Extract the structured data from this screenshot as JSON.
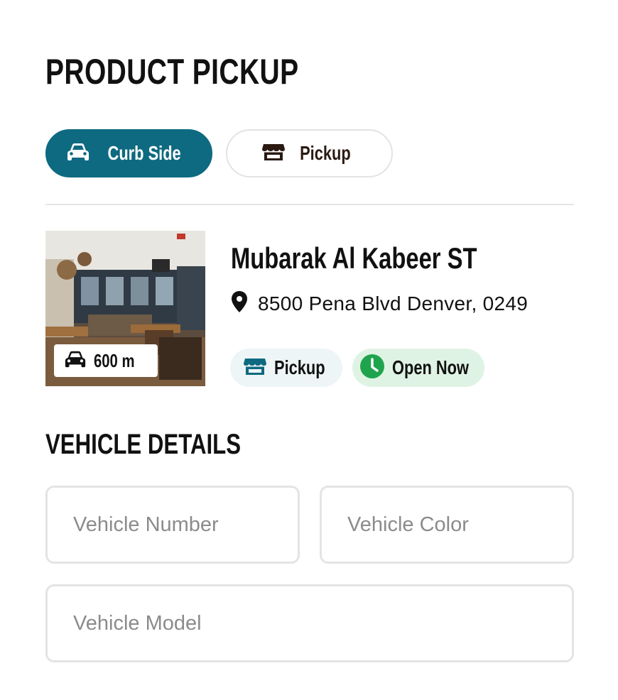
{
  "page": {
    "title": "PRODUCT PICKUP"
  },
  "mode_toggle": {
    "options": [
      {
        "label": "Curb Side",
        "icon": "car-icon",
        "active": true
      },
      {
        "label": "Pickup",
        "icon": "store-icon",
        "active": false
      }
    ]
  },
  "store": {
    "name": "Mubarak Al Kabeer ST",
    "address": "8500 Pena Blvd Denver, 0249",
    "distance": "600 m",
    "chips": {
      "pickup": "Pickup",
      "status": "Open Now"
    }
  },
  "vehicle": {
    "section_title": "VEHICLE DETAILS",
    "number_placeholder": "Vehicle Number",
    "color_placeholder": "Vehicle Color",
    "model_placeholder": "Vehicle Model"
  },
  "colors": {
    "accent": "#0e6a80",
    "open_green": "#1fa44d",
    "open_bg": "#dff3e4",
    "pickup_bg": "#eef5f6"
  }
}
